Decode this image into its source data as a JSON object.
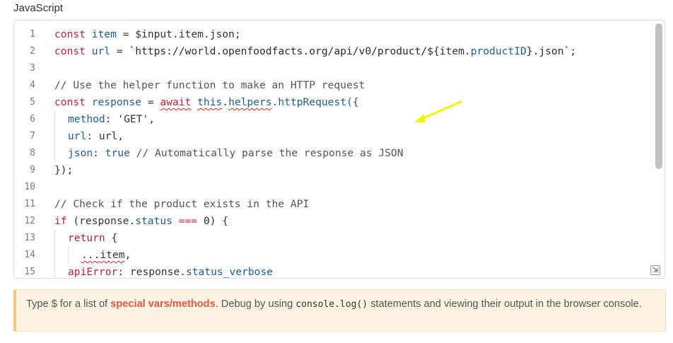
{
  "field_label": "JavaScript",
  "code_lines": [
    {
      "n": "1"
    },
    {
      "n": "2"
    },
    {
      "n": "3"
    },
    {
      "n": "4"
    },
    {
      "n": "5"
    },
    {
      "n": "6"
    },
    {
      "n": "7"
    },
    {
      "n": "8"
    },
    {
      "n": "9"
    },
    {
      "n": "10"
    },
    {
      "n": "11"
    },
    {
      "n": "12"
    },
    {
      "n": "13"
    },
    {
      "n": "14"
    },
    {
      "n": "15"
    }
  ],
  "code": {
    "l1_kw": "const",
    "l1_var": "item",
    "l1_rest": " = $input.item.json;",
    "l2_kw": "const",
    "l2_var": "url",
    "l2_eq": " = ",
    "l2_str": "`https://world.openfoodfacts.org/api/v0/product/${",
    "l2_item": "item.",
    "l2_prop": "productID",
    "l2_end": "}.json`;",
    "l4_comment": "// Use the helper function to make an HTTP request",
    "l5_kw": "const",
    "l5_var": "response",
    "l5_eq": " = ",
    "l5_await": "await",
    "l5_this": "this",
    "l5_helpers": "helpers",
    "l5_call": ".httpRequest({",
    "l6_key": "method",
    "l6_val": ": 'GET',",
    "l7_key": "url",
    "l7_val": ": url,",
    "l8_key": "json",
    "l8_colon": ": ",
    "l8_val": "true",
    "l8_comment": " // Automatically parse the response as JSON",
    "l9": "});",
    "l11_comment": "// Check if the product exists in the API",
    "l12_kw": "if",
    "l12_open": " (response.",
    "l12_prop": "status",
    "l12_op": " === ",
    "l12_num": "0",
    "l12_end": ") {",
    "l13_kw": "return",
    "l13_end": " {",
    "l14_spread": "...",
    "l14_item": "item",
    "l14_end": ",",
    "l15_key": "apiError",
    "l15_mid": ": response.",
    "l15_prop": "status_verbose"
  },
  "hint": {
    "prefix": "Type $ for a list of ",
    "link": "special vars/methods",
    "middle": ". Debug by using ",
    "code": "console.log()",
    "suffix": " statements and viewing their output in the browser console."
  },
  "colors": {
    "keyword": "#c41e3a",
    "property": "#1e5aa0",
    "annotation_arrow": "#f5f500",
    "hint_bg": "#fef3e2"
  }
}
